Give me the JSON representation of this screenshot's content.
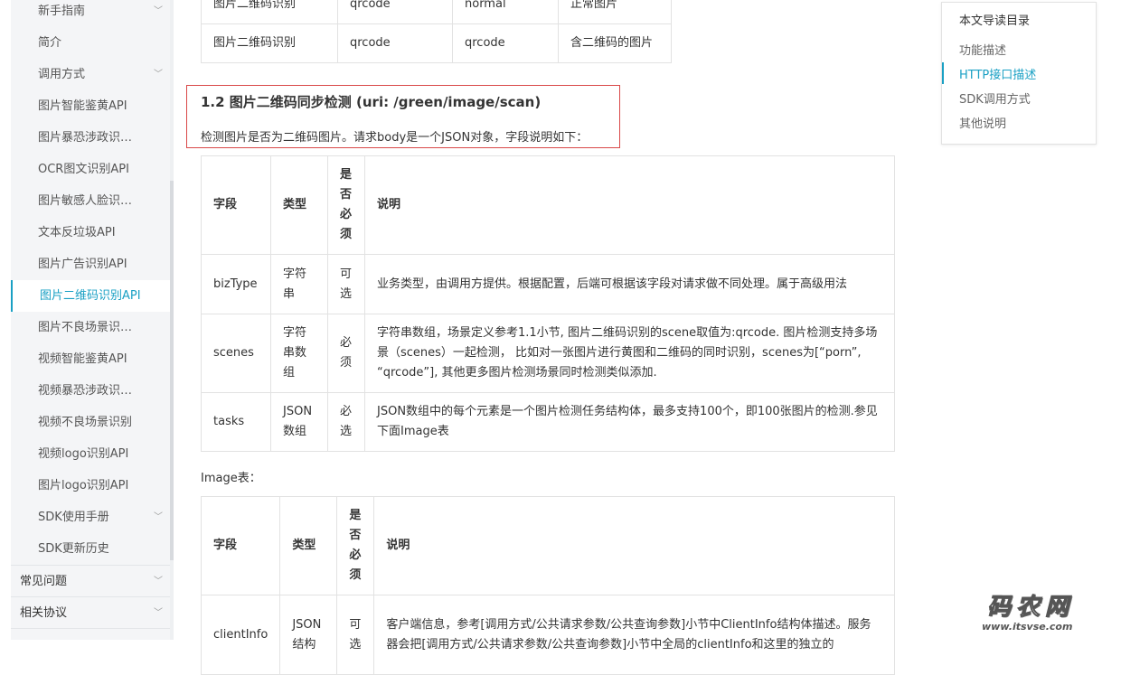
{
  "sidebar": {
    "items": [
      {
        "label": "新手指南",
        "chevron": true
      },
      {
        "label": "简介",
        "chevron": false
      },
      {
        "label": "调用方式",
        "chevron": true
      },
      {
        "label": "图片智能鉴黄API",
        "chevron": false
      },
      {
        "label": "图片暴恐涉政识…",
        "chevron": false
      },
      {
        "label": "OCR图文识别API",
        "chevron": false
      },
      {
        "label": "图片敏感人脸识…",
        "chevron": false
      },
      {
        "label": "文本反垃圾API",
        "chevron": false
      },
      {
        "label": "图片广告识别API",
        "chevron": false
      },
      {
        "label": "图片二维码识别API",
        "chevron": false,
        "active": true
      },
      {
        "label": "图片不良场景识…",
        "chevron": false
      },
      {
        "label": "视频智能鉴黄API",
        "chevron": false
      },
      {
        "label": "视频暴恐涉政识…",
        "chevron": false
      },
      {
        "label": "视频不良场景识别",
        "chevron": false
      },
      {
        "label": "视频logo识别API",
        "chevron": false
      },
      {
        "label": "图片logo识别API",
        "chevron": false
      },
      {
        "label": "SDK使用手册",
        "chevron": true
      },
      {
        "label": "SDK更新历史",
        "chevron": false
      }
    ],
    "top_items": [
      {
        "label": "常见问题",
        "chevron": true
      },
      {
        "label": "相关协议",
        "chevron": true
      }
    ],
    "chevron_glyph": "﹀"
  },
  "top_table": {
    "rows": [
      [
        "图片二维码识别",
        "qrcode",
        "normal",
        "正常图片"
      ],
      [
        "图片二维码识别",
        "qrcode",
        "qrcode",
        "含二维码的图片"
      ]
    ]
  },
  "section": {
    "title": "1.2 图片二维码同步检测 (uri: /green/image/scan)",
    "desc": "检测图片是否为二维码图片。请求body是一个JSON对象，字段说明如下："
  },
  "fields_table": {
    "headers": {
      "field": "字段",
      "type": "类型",
      "required": "是否必须",
      "desc": "说明"
    },
    "rows": [
      {
        "field": "bizType",
        "type": "字符串",
        "required": "可选",
        "desc": "业务类型，由调用方提供。根据配置，后端可根据该字段对请求做不同处理。属于高级用法"
      },
      {
        "field": "scenes",
        "type": "字符串数组",
        "required": "必须",
        "desc": "字符串数组，场景定义参考1.1小节, 图片二维码识别的scene取值为:qrcode. 图片检测支持多场景（scenes）一起检测， 比如对一张图片进行黄图和二维码的同时识别，scenes为[“porn”, “qrcode”], 其他更多图片检测场景同时检测类似添加."
      },
      {
        "field": "tasks",
        "type": "JSON数组",
        "required": "必选",
        "desc": "JSON数组中的每个元素是一个图片检测任务结构体，最多支持100个，即100张图片的检测.参见下面Image表"
      }
    ]
  },
  "image_label": "Image表：",
  "image_table": {
    "headers": {
      "field": "字段",
      "type": "类型",
      "required": "是否必须",
      "desc": "说明"
    },
    "rows": [
      {
        "field": "clientInfo",
        "type": "JSON结构",
        "required": "可选",
        "desc": "客户端信息，参考[调用方式/公共请求参数/公共查询参数]小节中ClientInfo结构体描述。服务器会把[调用方式/公共请求参数/公共查询参数]小节中全局的clientInfo和这里的独立的"
      }
    ]
  },
  "toc": {
    "title": "本文导读目录",
    "items": [
      {
        "label": "功能描述"
      },
      {
        "label": "HTTP接口描述",
        "active": true
      },
      {
        "label": "SDK调用方式"
      },
      {
        "label": "其他说明"
      }
    ]
  },
  "watermark": {
    "big": "码农网",
    "small": "www.itsvse.com"
  },
  "colors": {
    "accent": "#1aa0c4",
    "highlight_border": "#d94848",
    "sidebar_bg": "#f4f5f7"
  }
}
